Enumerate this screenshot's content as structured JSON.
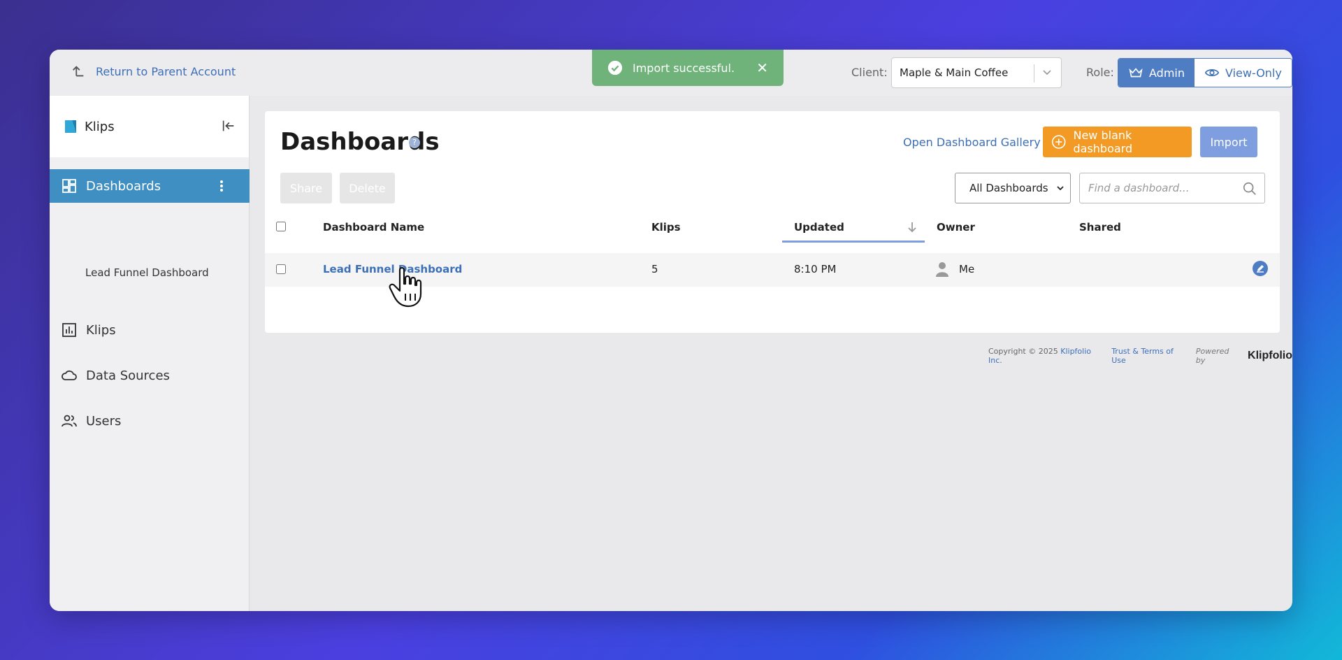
{
  "topbar": {
    "return_label": "Return to Parent Account",
    "toast_message": "Import successful.",
    "client_label": "Client:",
    "client_value": "Maple & Main Coffee",
    "role_label": "Role:",
    "role_admin": "Admin",
    "role_viewonly": "View-Only"
  },
  "sidebar": {
    "brand": "Klips",
    "items": [
      {
        "label": "Dashboards",
        "icon": "dashboard-icon",
        "active": true
      },
      {
        "label": "Klips",
        "icon": "chart-icon"
      },
      {
        "label": "Data Sources",
        "icon": "cloud-icon"
      },
      {
        "label": "Users",
        "icon": "users-icon"
      }
    ],
    "sub_item": "Lead Funnel Dashboard"
  },
  "main": {
    "title": "Dashboards",
    "help_glyph": "?",
    "gallery_link": "Open Dashboard Gallery",
    "new_button": "New blank dashboard",
    "import_button": "Import",
    "share_button": "Share",
    "delete_button": "Delete",
    "filter_value": "All Dashboards",
    "search_placeholder": "Find a dashboard...",
    "columns": [
      "Dashboard Name",
      "Klips",
      "Updated",
      "Owner",
      "Shared"
    ],
    "rows": [
      {
        "name": "Lead Funnel Dashboard",
        "klips": "5",
        "updated": "8:10 PM",
        "owner": "Me",
        "shared": ""
      }
    ]
  },
  "footer": {
    "copyright": "Copyright © 2025",
    "company": "Klipfolio Inc.",
    "terms": "Trust & Terms of Use",
    "powered": "Powered by",
    "logo": "Klipfolio"
  },
  "colors": {
    "accent": "#3f8fc2",
    "link": "#3d6fb6",
    "orange": "#f39a24",
    "toast": "#6fb37a"
  }
}
